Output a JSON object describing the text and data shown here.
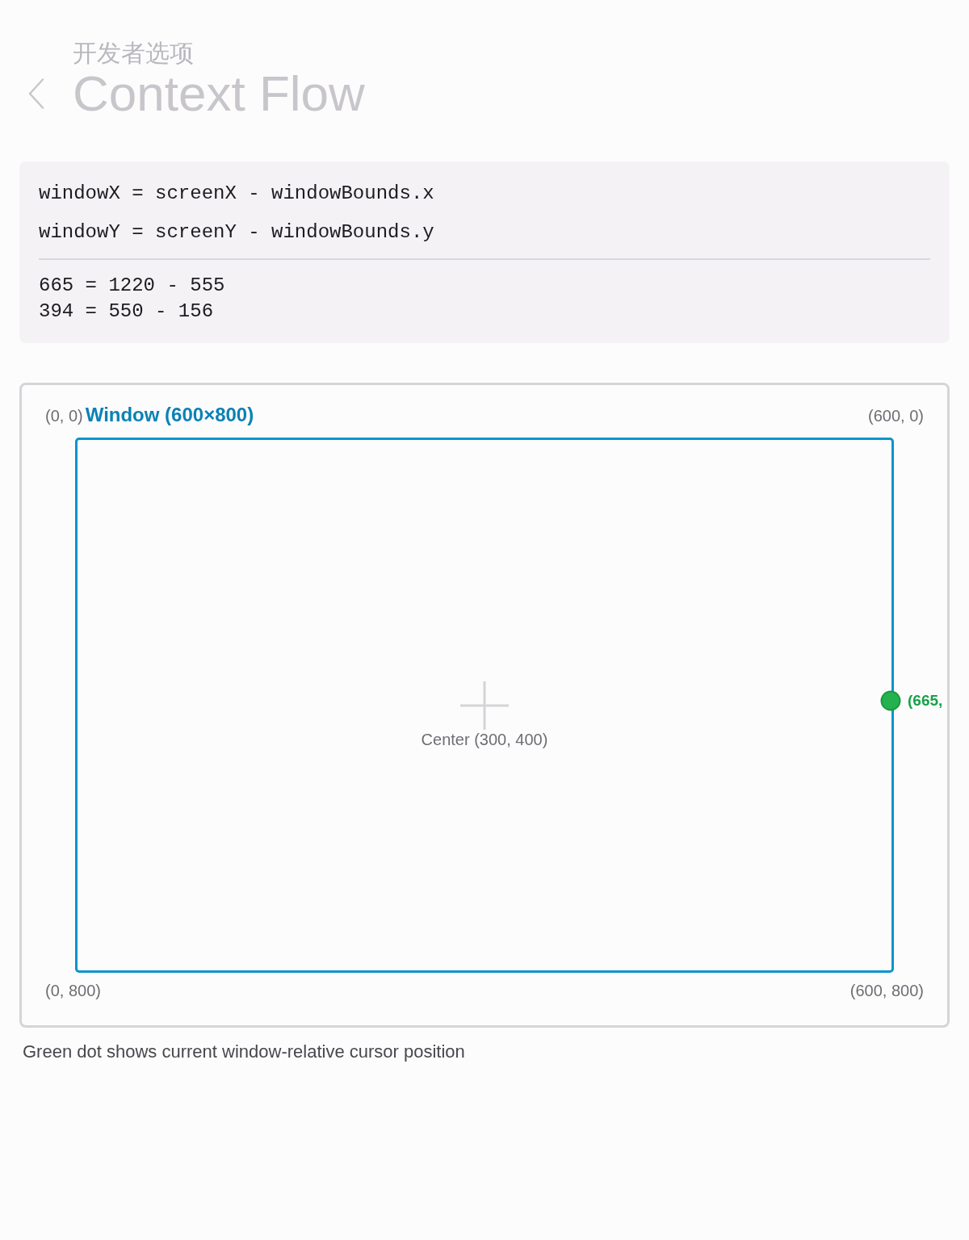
{
  "header": {
    "parent": "开发者选项",
    "title": "Context Flow"
  },
  "formula": {
    "lines": [
      "windowX = screenX - windowBounds.x",
      "windowY = screenY - windowBounds.y"
    ],
    "values": [
      "665 = 1220 - 555",
      "394 = 550 - 156"
    ]
  },
  "diagram": {
    "window_label": "Window (600×800)",
    "corners": {
      "top_left": "(0, 0)",
      "top_right": "(600, 0)",
      "bottom_left": "(0, 800)",
      "bottom_right": "(600, 800)"
    },
    "center_label": "Center (300, 400)",
    "cursor_label": "(665,"
  },
  "caption": "Green dot shows current window-relative cursor position"
}
